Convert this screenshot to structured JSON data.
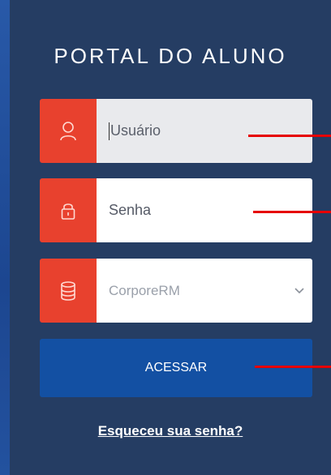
{
  "page": {
    "title": "PORTAL DO ALUNO"
  },
  "login_form": {
    "username": {
      "placeholder": "Usuário",
      "icon": "user-icon"
    },
    "password": {
      "placeholder": "Senha",
      "icon": "lock-icon"
    },
    "database": {
      "selected": "CorporeRM",
      "icon": "database-icon"
    },
    "submit_label": "ACESSAR",
    "forgot_label": "Esqueceu sua senha?"
  },
  "colors": {
    "panel": "#253d63",
    "icon_box": "#e8412e",
    "button": "#1350a3",
    "annotation": "#e60000"
  }
}
